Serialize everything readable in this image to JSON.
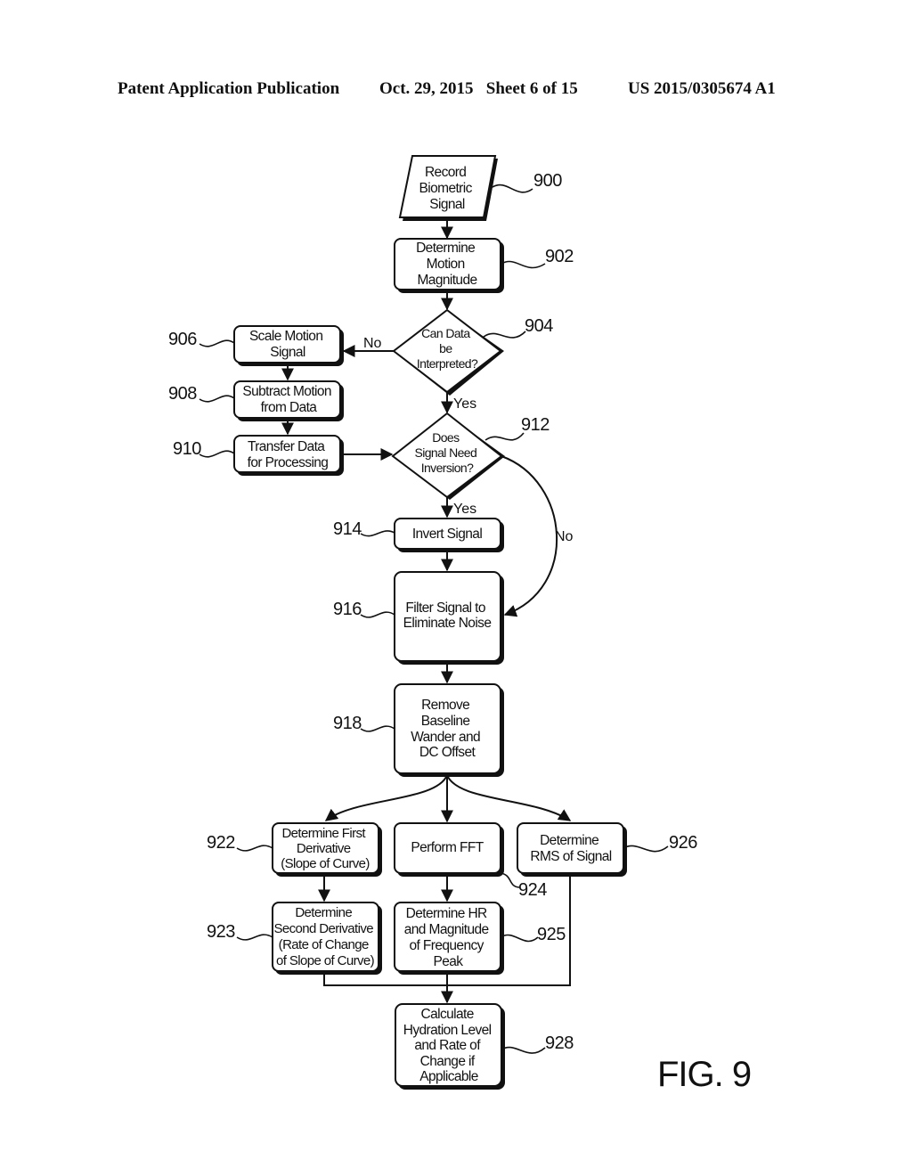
{
  "header": {
    "publication": "Patent Application Publication",
    "date_sheet": "Oct. 29, 2015   Sheet 6 of 15",
    "patent_number": "US 2015/0305674 A1"
  },
  "figure_label": "FIG. 9",
  "nodes": {
    "n900": {
      "ref": "900",
      "shape": "parallelogram",
      "lines": [
        "Record",
        "Biometric",
        "Signal"
      ]
    },
    "n902": {
      "ref": "902",
      "shape": "process",
      "lines": [
        "Determine",
        "Motion",
        "Magnitude"
      ]
    },
    "n904": {
      "ref": "904",
      "shape": "decision",
      "lines": [
        "Can Data",
        "be",
        "Interpreted?"
      ]
    },
    "n906": {
      "ref": "906",
      "shape": "process",
      "lines": [
        "Scale Motion",
        "Signal"
      ]
    },
    "n908": {
      "ref": "908",
      "shape": "process",
      "lines": [
        "Subtract Motion",
        "from Data"
      ]
    },
    "n910": {
      "ref": "910",
      "shape": "process",
      "lines": [
        "Transfer Data",
        "for Processing"
      ]
    },
    "n912": {
      "ref": "912",
      "shape": "decision",
      "lines": [
        "Does",
        "Signal Need",
        "Inversion?"
      ]
    },
    "n914": {
      "ref": "914",
      "shape": "process",
      "lines": [
        "Invert Signal"
      ]
    },
    "n916": {
      "ref": "916",
      "shape": "process",
      "lines": [
        "Filter Signal to",
        "Eliminate Noise"
      ]
    },
    "n918": {
      "ref": "918",
      "shape": "process",
      "lines": [
        "Remove",
        "Baseline",
        "Wander and",
        "DC Offset"
      ]
    },
    "n922": {
      "ref": "922",
      "shape": "process",
      "lines": [
        "Determine First",
        "Derivative",
        "(Slope of Curve)"
      ]
    },
    "n923": {
      "ref": "923",
      "shape": "process",
      "lines": [
        "Determine",
        "Second Derivative",
        "(Rate of Change",
        "of Slope of Curve)"
      ]
    },
    "n924": {
      "ref": "924",
      "shape": "process",
      "lines": [
        "Perform FFT"
      ]
    },
    "n925": {
      "ref": "925",
      "shape": "process",
      "lines": [
        "Determine HR",
        "and Magnitude",
        "of Frequency",
        "Peak"
      ]
    },
    "n926": {
      "ref": "926",
      "shape": "process",
      "lines": [
        "Determine",
        "RMS of Signal"
      ]
    },
    "n928": {
      "ref": "928",
      "shape": "process",
      "lines": [
        "Calculate",
        "Hydration Level",
        "and Rate of",
        "Change if",
        "Applicable"
      ]
    }
  },
  "edge_labels": {
    "n904_no": "No",
    "n904_yes": "Yes",
    "n912_yes": "Yes",
    "n912_no": "No"
  },
  "edges": [
    {
      "from": "900",
      "to": "902"
    },
    {
      "from": "902",
      "to": "904"
    },
    {
      "from": "904",
      "to": "906",
      "label": "No"
    },
    {
      "from": "904",
      "to": "912",
      "label": "Yes"
    },
    {
      "from": "906",
      "to": "908"
    },
    {
      "from": "908",
      "to": "910"
    },
    {
      "from": "910",
      "to": "912"
    },
    {
      "from": "912",
      "to": "914",
      "label": "Yes"
    },
    {
      "from": "912",
      "to": "916",
      "label": "No"
    },
    {
      "from": "914",
      "to": "916"
    },
    {
      "from": "916",
      "to": "918"
    },
    {
      "from": "918",
      "to": "922"
    },
    {
      "from": "918",
      "to": "924"
    },
    {
      "from": "918",
      "to": "926"
    },
    {
      "from": "922",
      "to": "923"
    },
    {
      "from": "924",
      "to": "925"
    },
    {
      "from": "923",
      "to": "928"
    },
    {
      "from": "925",
      "to": "928"
    },
    {
      "from": "926",
      "to": "928"
    }
  ]
}
